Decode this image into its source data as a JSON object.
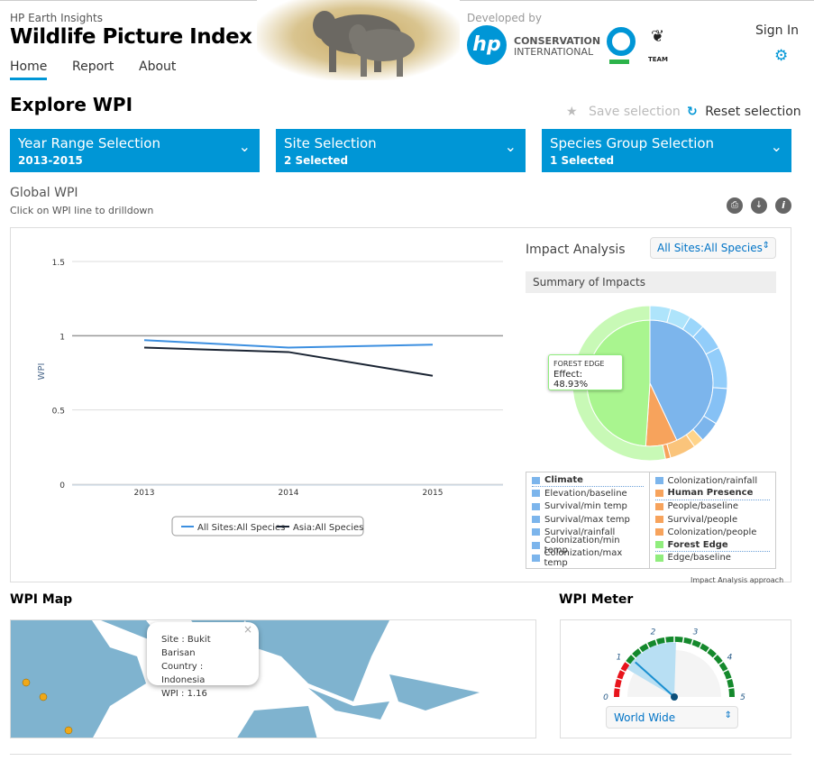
{
  "header": {
    "subtitle": "HP Earth Insights",
    "title": "Wildlife Picture Index",
    "nav": [
      "Home",
      "Report",
      "About"
    ],
    "developed_by": "Developed by",
    "partners": {
      "hp": "hp",
      "ci_line1": "CONSERVATION",
      "ci_line2": "INTERNATIONAL",
      "team": "TEAM"
    },
    "sign_in": "Sign In"
  },
  "explore": {
    "title": "Explore WPI",
    "save": "Save selection",
    "reset": "Reset selection",
    "filters": [
      {
        "label": "Year Range Selection",
        "value": "2013-2015"
      },
      {
        "label": "Site Selection",
        "value": "2 Selected"
      },
      {
        "label": "Species Group Selection",
        "value": "1 Selected"
      }
    ]
  },
  "global": {
    "title": "Global WPI",
    "hint": "Click on WPI line to drilldown"
  },
  "chart_data": {
    "type": "line",
    "xlabel": "",
    "ylabel": "WPI",
    "ylim": [
      0,
      1.5
    ],
    "yticks": [
      "0",
      "0.5",
      "1",
      "1.5"
    ],
    "categories": [
      "2013",
      "2014",
      "2015"
    ],
    "reference_line": 1,
    "series": [
      {
        "name": "All Sites:All Species",
        "color": "#3c8fe0",
        "values": [
          0.97,
          0.92,
          0.94
        ]
      },
      {
        "name": "Asia:All Species",
        "color": "#1a2433",
        "values": [
          0.92,
          0.89,
          0.73
        ]
      }
    ],
    "legend": "bottom"
  },
  "impact": {
    "title": "Impact Analysis",
    "select": "All Sites:All Species",
    "summary": "Summary of Impacts",
    "tooltip_title": "FOREST EDGE",
    "tooltip_value": "Effect: 48.93%",
    "approach": "Impact Analysis approach",
    "pie_inner": [
      {
        "name": "Climate",
        "value": 43,
        "color": "#7cb5ec"
      },
      {
        "name": "Human Presence",
        "value": 8.07,
        "color": "#f7a35c"
      },
      {
        "name": "Forest Edge",
        "value": 48.93,
        "color": "#a9f58f"
      }
    ],
    "pie_outer": [
      {
        "value": 4,
        "color": "#aee4fb"
      },
      {
        "value": 4,
        "color": "#aee4fb"
      },
      {
        "value": 3,
        "color": "#9bd6fb"
      },
      {
        "value": 5,
        "color": "#92cdfa"
      },
      {
        "value": 8,
        "color": "#92cdfa"
      },
      {
        "value": 7,
        "color": "#86c1f5"
      },
      {
        "value": 4,
        "color": "#7cb5ec"
      },
      {
        "value": 2,
        "color": "#ffd48a"
      },
      {
        "value": 5,
        "color": "#fac47b"
      },
      {
        "value": 1,
        "color": "#f7a35c"
      },
      {
        "value": 48.93,
        "color": "#c8f9b6"
      }
    ],
    "legend_left": [
      {
        "label": "Climate",
        "color": "#7cb5ec",
        "bold": true
      },
      {
        "label": "Elevation/baseline",
        "color": "#7cb5ec"
      },
      {
        "label": "Survival/min temp",
        "color": "#7cb5ec"
      },
      {
        "label": "Survival/max temp",
        "color": "#7cb5ec"
      },
      {
        "label": "Survival/rainfall",
        "color": "#7cb5ec"
      },
      {
        "label": "Colonization/min temp",
        "color": "#7cb5ec"
      },
      {
        "label": "Colonization/max temp",
        "color": "#7cb5ec"
      }
    ],
    "legend_right": [
      {
        "label": "Colonization/rainfall",
        "color": "#7cb5ec"
      },
      {
        "label": "Human Presence",
        "color": "#f7a35c",
        "bold": true
      },
      {
        "label": "People/baseline",
        "color": "#f7a35c"
      },
      {
        "label": "Survival/people",
        "color": "#f7a35c"
      },
      {
        "label": "Colonization/people",
        "color": "#f7a35c"
      },
      {
        "label": "Forest Edge",
        "color": "#90ed7d",
        "bold": true
      },
      {
        "label": "Edge/baseline",
        "color": "#90ed7d"
      }
    ]
  },
  "map": {
    "title": "WPI Map",
    "popup": [
      "Site : Bukit Barisan",
      "Country : Indonesia",
      "WPI : 1.16"
    ]
  },
  "meter": {
    "title": "WPI Meter",
    "ticks": [
      "0",
      "1",
      "2",
      "3",
      "4",
      "5"
    ],
    "value": 1.16,
    "select": "World Wide"
  }
}
